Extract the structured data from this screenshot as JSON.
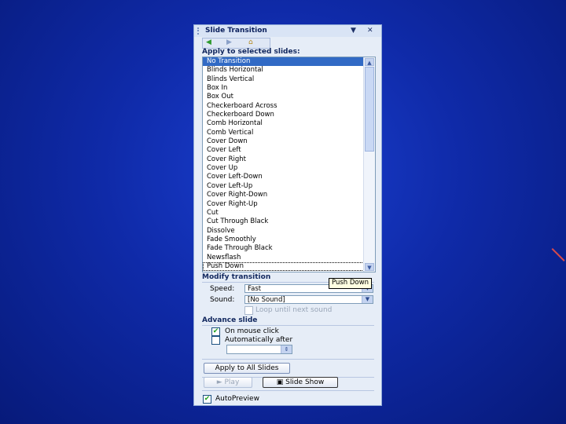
{
  "pane": {
    "title": "Slide Transition",
    "dropdown_glyph": "▼",
    "close_glyph": "✕",
    "nav": {
      "back_glyph": "◀",
      "forward_glyph": "▶",
      "home_glyph": "⌂"
    }
  },
  "apply_section": {
    "label": "Apply to selected slides:",
    "items": [
      "No Transition",
      "Blinds Horizontal",
      "Blinds Vertical",
      "Box In",
      "Box Out",
      "Checkerboard Across",
      "Checkerboard Down",
      "Comb Horizontal",
      "Comb Vertical",
      "Cover Down",
      "Cover Left",
      "Cover Right",
      "Cover Up",
      "Cover Left-Down",
      "Cover Left-Up",
      "Cover Right-Down",
      "Cover Right-Up",
      "Cut",
      "Cut Through Black",
      "Dissolve",
      "Fade Smoothly",
      "Fade Through Black",
      "Newsflash",
      "Push Down"
    ],
    "selected_item": "No Transition",
    "focused_item": "Push Down",
    "tooltip": "Push Down"
  },
  "modify_section": {
    "label": "Modify transition",
    "speed_label": "Speed:",
    "speed_value": "Fast",
    "sound_label": "Sound:",
    "sound_value": "[No Sound]",
    "loop_label": "Loop until next sound",
    "loop_checked": false
  },
  "advance_section": {
    "label": "Advance slide",
    "on_mouse_click_label": "On mouse click",
    "on_mouse_click_checked": true,
    "auto_after_label": "Automatically after",
    "auto_after_checked": false,
    "auto_after_value": ""
  },
  "buttons": {
    "apply_all": "Apply to All Slides",
    "play": "Play",
    "slide_show": "Slide Show"
  },
  "autopreview": {
    "label": "AutoPreview",
    "checked": true
  },
  "colors": {
    "background": "#0f2aa8",
    "selection": "#316ac5",
    "pane": "#e6edf7"
  }
}
